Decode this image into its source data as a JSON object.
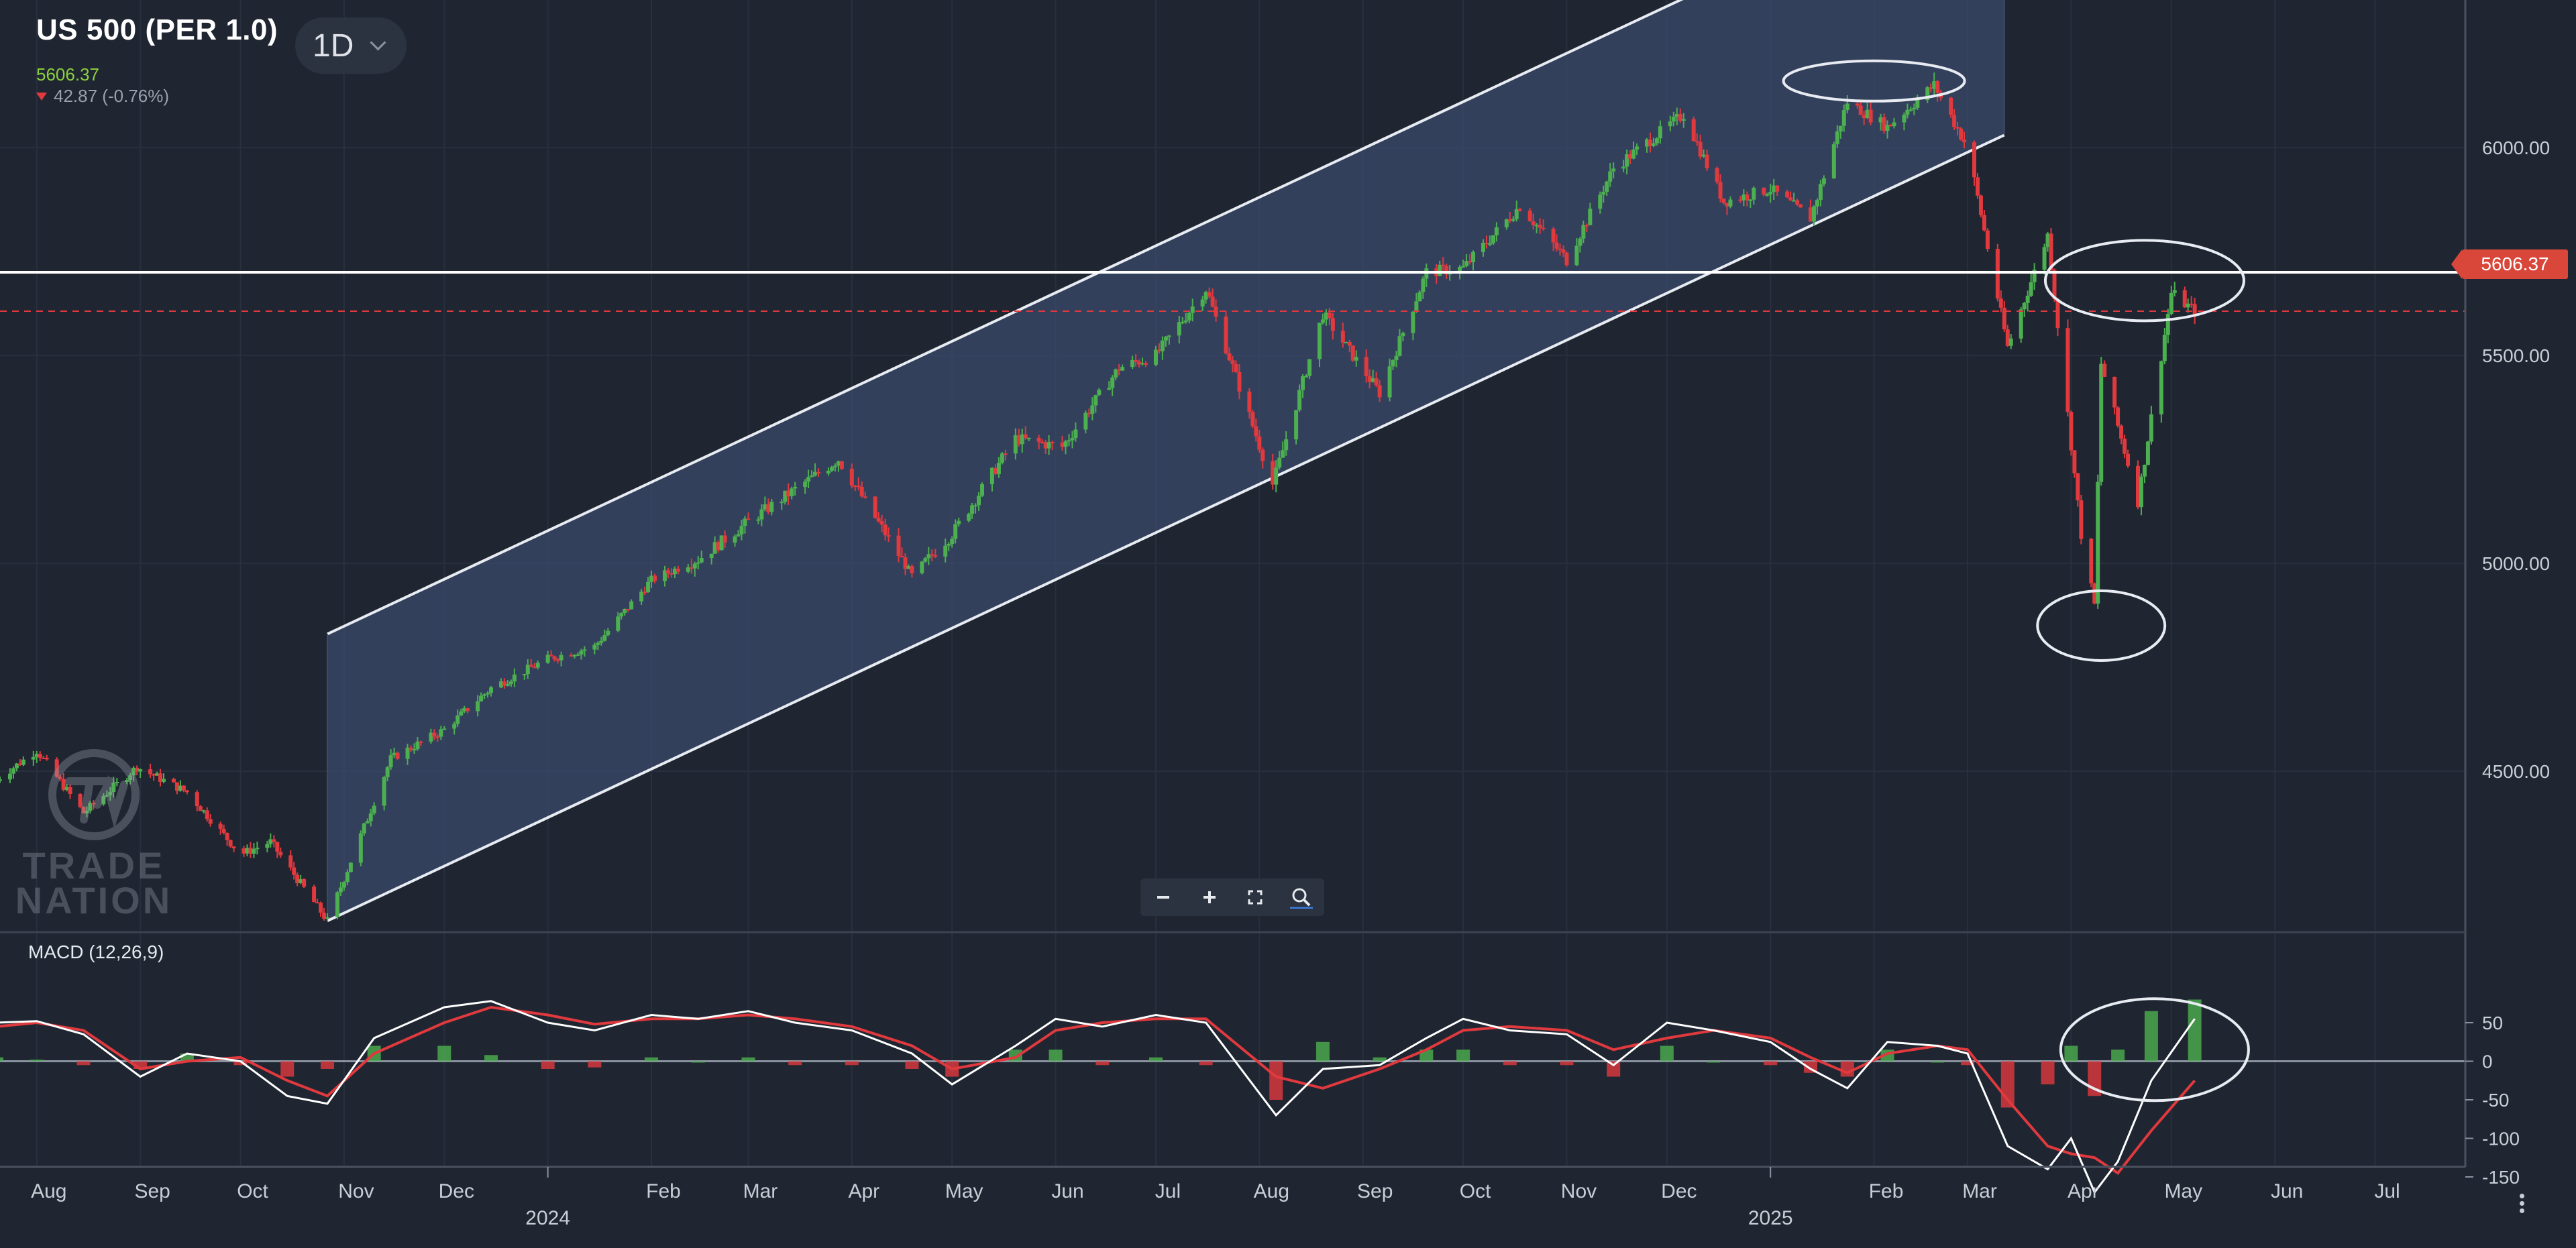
{
  "header": {
    "symbol": "US 500 (PER 1.0)",
    "timeframe": "1D",
    "price": "5606.37",
    "change": "42.87 (-0.76%)"
  },
  "indicator": {
    "label": "MACD (12,26,9)"
  },
  "watermark": {
    "line1": "TRADE",
    "line2": "NATION"
  },
  "price_tag": "5606.37",
  "colors": {
    "background": "#1f2631",
    "up": "#4caf50",
    "down": "#e0393e",
    "channel_fill": "#3b4a6b",
    "channel_line": "#e8ecf2",
    "macd_line": "#ffffff",
    "signal_line": "#e0393e"
  },
  "toolbar": [
    "zoom-out-icon",
    "zoom-in-icon",
    "fullscreen-icon",
    "magnifier-icon"
  ],
  "chart_data": [
    {
      "type": "line",
      "title": "US 500 (PER 1.0)",
      "x_tick_labels": [
        "Aug",
        "Sep",
        "Oct",
        "Nov",
        "Dec",
        "2024",
        "Feb",
        "Mar",
        "Apr",
        "May",
        "Jun",
        "Jul",
        "Aug",
        "Sep",
        "Oct",
        "Nov",
        "Dec",
        "2025",
        "Feb",
        "Mar",
        "Apr",
        "May",
        "Jun",
        "Jul"
      ],
      "year_labels": [
        "2024",
        "2025"
      ],
      "y_tick_labels": [
        "6000.00",
        "5500.00",
        "5000.00",
        "4500.00"
      ],
      "ylim": [
        4120,
        6230
      ],
      "last_price": 5606.37,
      "horizontal_level": 5700,
      "x": [
        "2023-07-20",
        "2023-08-01",
        "2023-08-15",
        "2023-08-31",
        "2023-09-15",
        "2023-10-01",
        "2023-10-10",
        "2023-10-27",
        "2023-11-15",
        "2023-12-01",
        "2023-12-15",
        "2024-01-01",
        "2024-01-15",
        "2024-02-01",
        "2024-02-15",
        "2024-03-01",
        "2024-03-28",
        "2024-04-19",
        "2024-05-01",
        "2024-05-20",
        "2024-06-03",
        "2024-06-20",
        "2024-07-01",
        "2024-07-16",
        "2024-08-05",
        "2024-08-20",
        "2024-09-06",
        "2024-09-20",
        "2024-10-01",
        "2024-10-18",
        "2024-11-01",
        "2024-11-15",
        "2024-12-06",
        "2024-12-18",
        "2025-01-01",
        "2025-01-13",
        "2025-01-24",
        "2025-02-05",
        "2025-02-19",
        "2025-03-01",
        "2025-03-13",
        "2025-03-25",
        "2025-04-04",
        "2025-04-08",
        "2025-04-10",
        "2025-04-21",
        "2025-05-01",
        "2025-05-08"
      ],
      "close": [
        4480,
        4550,
        4400,
        4510,
        4450,
        4300,
        4330,
        4140,
        4530,
        4600,
        4700,
        4770,
        4800,
        4960,
        5010,
        5100,
        5250,
        4970,
        5070,
        5300,
        5280,
        5470,
        5500,
        5660,
        5190,
        5600,
        5410,
        5700,
        5710,
        5860,
        5730,
        5950,
        6080,
        5870,
        5900,
        5830,
        6110,
        6050,
        6150,
        6000,
        5520,
        5790,
        5070,
        4900,
        5480,
        5150,
        5650,
        5606
      ],
      "channel": {
        "lower_start": [
          "2023-10-27",
          4140
        ],
        "lower_end": [
          "2025-03-12",
          6030
        ],
        "upper_start": [
          "2023-10-27",
          4830
        ],
        "upper_end": [
          "2025-03-12",
          6720
        ]
      }
    },
    {
      "type": "line",
      "title": "MACD (12,26,9)",
      "y_tick_labels": [
        "50",
        "0",
        "-50",
        "-100",
        "-150"
      ],
      "ylim": [
        -200,
        85
      ],
      "x": [
        "2023-07-20",
        "2023-08-01",
        "2023-08-15",
        "2023-09-01",
        "2023-09-15",
        "2023-10-01",
        "2023-10-15",
        "2023-10-27",
        "2023-11-10",
        "2023-12-01",
        "2023-12-15",
        "2024-01-01",
        "2024-01-15",
        "2024-02-01",
        "2024-02-15",
        "2024-03-01",
        "2024-03-15",
        "2024-04-01",
        "2024-04-19",
        "2024-05-01",
        "2024-05-20",
        "2024-06-01",
        "2024-06-15",
        "2024-07-01",
        "2024-07-16",
        "2024-08-06",
        "2024-08-20",
        "2024-09-06",
        "2024-09-20",
        "2024-10-01",
        "2024-10-15",
        "2024-11-01",
        "2024-11-15",
        "2024-12-01",
        "2024-12-15",
        "2025-01-01",
        "2025-01-13",
        "2025-01-24",
        "2025-02-05",
        "2025-02-20",
        "2025-03-01",
        "2025-03-13",
        "2025-03-25",
        "2025-04-01",
        "2025-04-08",
        "2025-04-15",
        "2025-04-25",
        "2025-05-08"
      ],
      "series": [
        {
          "name": "MACD",
          "values": [
            50,
            52,
            35,
            -20,
            10,
            0,
            -45,
            -55,
            30,
            70,
            78,
            50,
            40,
            60,
            55,
            65,
            50,
            40,
            10,
            -30,
            20,
            55,
            45,
            60,
            50,
            -70,
            -10,
            -5,
            30,
            55,
            40,
            35,
            -5,
            50,
            40,
            25,
            -10,
            -35,
            25,
            20,
            10,
            -110,
            -140,
            -100,
            -170,
            -130,
            -25,
            55
          ]
        },
        {
          "name": "Signal",
          "values": [
            45,
            50,
            40,
            -10,
            0,
            5,
            -25,
            -45,
            10,
            50,
            70,
            60,
            48,
            55,
            55,
            60,
            55,
            45,
            20,
            -10,
            5,
            40,
            50,
            55,
            55,
            -20,
            -35,
            -10,
            15,
            40,
            45,
            40,
            15,
            30,
            40,
            30,
            5,
            -15,
            10,
            20,
            15,
            -50,
            -110,
            -120,
            -125,
            -145,
            -90,
            -25
          ]
        },
        {
          "name": "Histogram",
          "values": [
            5,
            2,
            -5,
            -10,
            10,
            -5,
            -20,
            -10,
            20,
            20,
            8,
            -10,
            -8,
            5,
            0,
            5,
            -5,
            -5,
            -10,
            -20,
            15,
            15,
            -5,
            5,
            -5,
            -50,
            25,
            5,
            15,
            15,
            -5,
            -5,
            -20,
            20,
            0,
            -5,
            -15,
            -20,
            15,
            0,
            -5,
            -60,
            -30,
            20,
            -45,
            15,
            65,
            80
          ]
        }
      ]
    }
  ]
}
